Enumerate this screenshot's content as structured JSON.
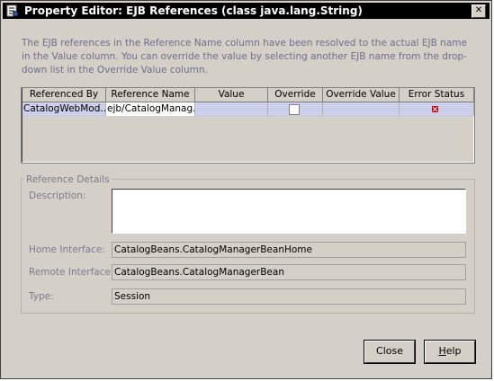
{
  "window": {
    "title": "Property Editor: EJB References (class java.lang.String)",
    "close_glyph": "✕"
  },
  "info_text": "The EJB references in the Reference Name column have been resolved to the actual EJB name in the Value column.  You can override the value by selecting another EJB name from the drop-down list in the Override Value column.",
  "table": {
    "columns": [
      "Referenced By",
      "Reference Name",
      "Value",
      "Override",
      "Override Value",
      "Error Status"
    ],
    "rows": [
      {
        "referenced_by": "CatalogWebMod...",
        "reference_name": "ejb/CatalogManag...",
        "value": "",
        "override": false,
        "override_value": "",
        "error_status_icon": "error-icon"
      }
    ]
  },
  "details": {
    "legend": "Reference Details",
    "description_label": "Description:",
    "description_value": "",
    "home_label": "Home Interface:",
    "home_value": "CatalogBeans.CatalogManagerBeanHome",
    "remote_label": "Remote Interface:",
    "remote_value": "CatalogBeans.CatalogManagerBean",
    "type_label": "Type:",
    "type_value": "Session"
  },
  "buttons": {
    "close": "Close",
    "help_mnemonic": "H",
    "help_rest": "elp"
  },
  "colors": {
    "title_bg": "#000000",
    "selection": "#c8cbe8",
    "error": "#cc0000"
  }
}
